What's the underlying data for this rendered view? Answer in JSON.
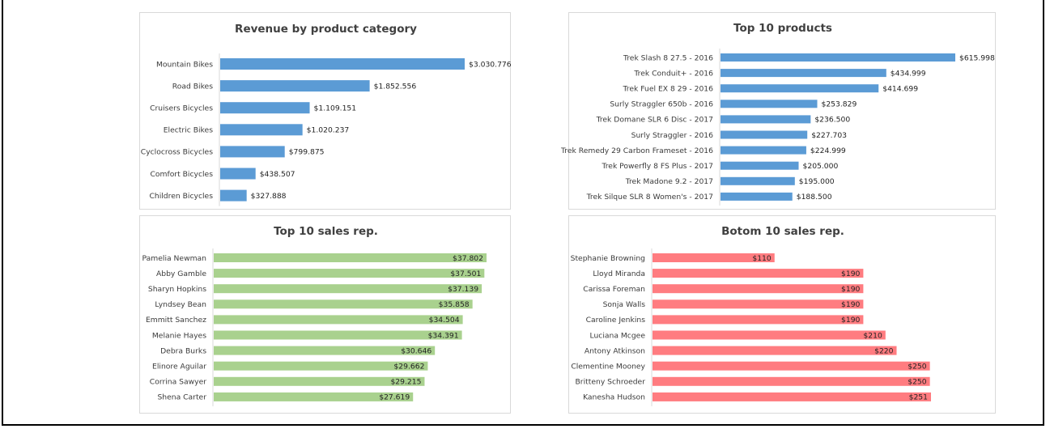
{
  "chart_data": [
    {
      "type": "bar",
      "orientation": "horizontal",
      "title": "Revenue by product category",
      "categories": [
        "Mountain Bikes",
        "Road Bikes",
        "Cruisers Bicycles",
        "Electric Bikes",
        "Cyclocross Bicycles",
        "Comfort Bicycles",
        "Children Bicycles"
      ],
      "values": [
        3030776,
        1852556,
        1109151,
        1020237,
        799875,
        438507,
        327888
      ],
      "labels": [
        "$3.030.776",
        "$1.852.556",
        "$1.109.151",
        "$1.020.237",
        "$799.875",
        "$438.507",
        "$327.888"
      ],
      "label_position": "outside",
      "color": "#5b9bd5",
      "xlim": [
        0,
        3030776
      ],
      "grid": false
    },
    {
      "type": "bar",
      "orientation": "horizontal",
      "title": "Top 10 products",
      "categories": [
        "Trek Slash 8 27.5 - 2016",
        "Trek Conduit+ - 2016",
        "Trek Fuel EX 8 29 - 2016",
        "Surly Straggler 650b - 2016",
        "Trek Domane SLR 6 Disc - 2017",
        "Surly Straggler - 2016",
        "Trek Remedy 29 Carbon Frameset - 2016",
        "Trek Powerfly 8 FS Plus - 2017",
        "Trek Madone 9.2 - 2017",
        "Trek Silque SLR 8 Women's - 2017"
      ],
      "values": [
        615998,
        434999,
        414699,
        253829,
        236500,
        227703,
        224999,
        205000,
        195000,
        188500
      ],
      "labels": [
        "$615.998",
        "$434.999",
        "$414.699",
        "$253.829",
        "$236.500",
        "$227.703",
        "$224.999",
        "$205.000",
        "$195.000",
        "$188.500"
      ],
      "label_position": "outside",
      "color": "#5b9bd5",
      "xlim": [
        0,
        615998
      ],
      "grid": false
    },
    {
      "type": "bar",
      "orientation": "horizontal",
      "title": "Top 10 sales rep.",
      "categories": [
        "Pamelia Newman",
        "Abby Gamble",
        "Sharyn Hopkins",
        "Lyndsey Bean",
        "Emmitt Sanchez",
        "Melanie Hayes",
        "Debra Burks",
        "Elinore Aguilar",
        "Corrina Sawyer",
        "Shena Carter"
      ],
      "values": [
        37802,
        37501,
        37139,
        35858,
        34504,
        34391,
        30646,
        29662,
        29215,
        27619
      ],
      "labels": [
        "$37.802",
        "$37.501",
        "$37.139",
        "$35.858",
        "$34.504",
        "$34.391",
        "$30.646",
        "$29.662",
        "$29.215",
        "$27.619"
      ],
      "label_position": "inside-end",
      "color": "#a9d18e",
      "xlim": [
        0,
        37802
      ],
      "grid": false
    },
    {
      "type": "bar",
      "orientation": "horizontal",
      "title": "Botom 10 sales rep.",
      "categories": [
        "Stephanie Browning",
        "Lloyd Miranda",
        "Carissa Foreman",
        "Sonja Walls",
        "Caroline Jenkins",
        "Luciana Mcgee",
        "Antony Atkinson",
        "Clementine Mooney",
        "Britteny Schroeder",
        "Kanesha Hudson"
      ],
      "values": [
        110,
        190,
        190,
        190,
        190,
        210,
        220,
        250,
        250,
        251
      ],
      "labels": [
        "$110",
        "$190",
        "$190",
        "$190",
        "$190",
        "$210",
        "$220",
        "$250",
        "$250",
        "$251"
      ],
      "label_position": "inside-end",
      "color": "#ff7c80",
      "xlim": [
        0,
        251
      ],
      "grid": false
    }
  ]
}
